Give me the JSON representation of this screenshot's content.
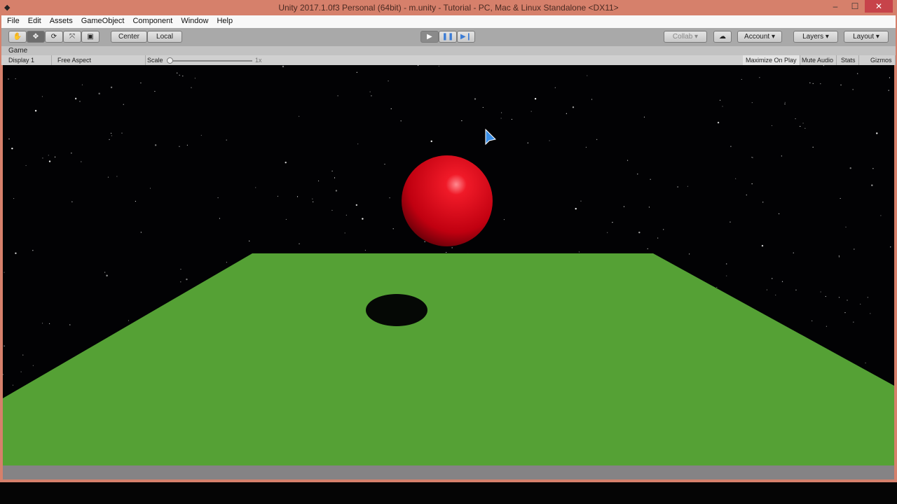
{
  "window": {
    "title": "Unity 2017.1.0f3 Personal (64bit) - m.unity - Tutorial - PC, Mac & Linux Standalone <DX11>",
    "minimize": "–",
    "maximize": "☐",
    "close": "✕"
  },
  "menu": [
    "File",
    "Edit",
    "Assets",
    "GameObject",
    "Component",
    "Window",
    "Help"
  ],
  "toolbar": {
    "tools": [
      "✋",
      "✥",
      "⟳",
      "⤧",
      "▣"
    ],
    "center": "Center",
    "local": "Local",
    "play": "▶",
    "pause": "❚❚",
    "step": "▶❙",
    "collab": "Collab ▾",
    "cloud": "☁",
    "account": "Account ▾",
    "layers": "Layers ▾",
    "layout": "Layout ▾"
  },
  "game": {
    "tab": "Game",
    "display": "Display 1",
    "aspect": "Free Aspect",
    "scale_label": "Scale",
    "scale_value": "1x",
    "maximize": "Maximize On Play",
    "mute": "Mute Audio",
    "stats": "Stats",
    "gizmos": "Gizmos"
  },
  "colors": {
    "plane": "#55a135",
    "ball": "#e01020"
  }
}
